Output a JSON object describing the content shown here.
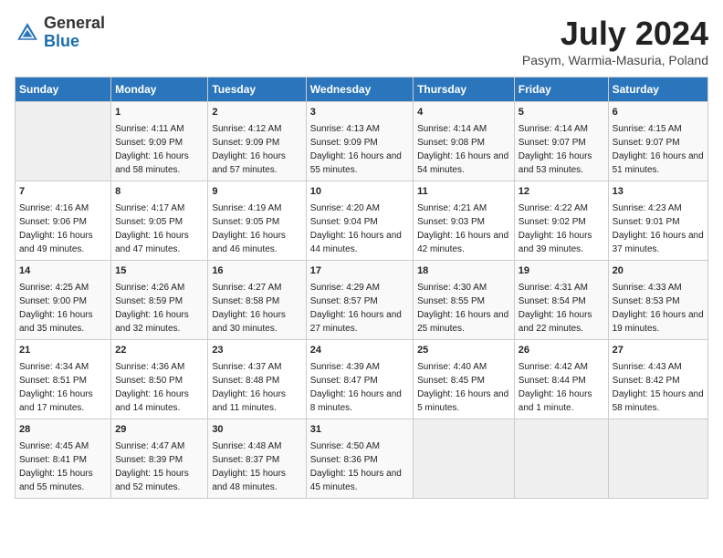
{
  "header": {
    "logo_general": "General",
    "logo_blue": "Blue",
    "month_title": "July 2024",
    "location": "Pasym, Warmia-Masuria, Poland"
  },
  "days_of_week": [
    "Sunday",
    "Monday",
    "Tuesday",
    "Wednesday",
    "Thursday",
    "Friday",
    "Saturday"
  ],
  "weeks": [
    [
      {
        "day": "",
        "sunrise": "",
        "sunset": "",
        "daylight": ""
      },
      {
        "day": "1",
        "sunrise": "Sunrise: 4:11 AM",
        "sunset": "Sunset: 9:09 PM",
        "daylight": "Daylight: 16 hours and 58 minutes."
      },
      {
        "day": "2",
        "sunrise": "Sunrise: 4:12 AM",
        "sunset": "Sunset: 9:09 PM",
        "daylight": "Daylight: 16 hours and 57 minutes."
      },
      {
        "day": "3",
        "sunrise": "Sunrise: 4:13 AM",
        "sunset": "Sunset: 9:09 PM",
        "daylight": "Daylight: 16 hours and 55 minutes."
      },
      {
        "day": "4",
        "sunrise": "Sunrise: 4:14 AM",
        "sunset": "Sunset: 9:08 PM",
        "daylight": "Daylight: 16 hours and 54 minutes."
      },
      {
        "day": "5",
        "sunrise": "Sunrise: 4:14 AM",
        "sunset": "Sunset: 9:07 PM",
        "daylight": "Daylight: 16 hours and 53 minutes."
      },
      {
        "day": "6",
        "sunrise": "Sunrise: 4:15 AM",
        "sunset": "Sunset: 9:07 PM",
        "daylight": "Daylight: 16 hours and 51 minutes."
      }
    ],
    [
      {
        "day": "7",
        "sunrise": "Sunrise: 4:16 AM",
        "sunset": "Sunset: 9:06 PM",
        "daylight": "Daylight: 16 hours and 49 minutes."
      },
      {
        "day": "8",
        "sunrise": "Sunrise: 4:17 AM",
        "sunset": "Sunset: 9:05 PM",
        "daylight": "Daylight: 16 hours and 47 minutes."
      },
      {
        "day": "9",
        "sunrise": "Sunrise: 4:19 AM",
        "sunset": "Sunset: 9:05 PM",
        "daylight": "Daylight: 16 hours and 46 minutes."
      },
      {
        "day": "10",
        "sunrise": "Sunrise: 4:20 AM",
        "sunset": "Sunset: 9:04 PM",
        "daylight": "Daylight: 16 hours and 44 minutes."
      },
      {
        "day": "11",
        "sunrise": "Sunrise: 4:21 AM",
        "sunset": "Sunset: 9:03 PM",
        "daylight": "Daylight: 16 hours and 42 minutes."
      },
      {
        "day": "12",
        "sunrise": "Sunrise: 4:22 AM",
        "sunset": "Sunset: 9:02 PM",
        "daylight": "Daylight: 16 hours and 39 minutes."
      },
      {
        "day": "13",
        "sunrise": "Sunrise: 4:23 AM",
        "sunset": "Sunset: 9:01 PM",
        "daylight": "Daylight: 16 hours and 37 minutes."
      }
    ],
    [
      {
        "day": "14",
        "sunrise": "Sunrise: 4:25 AM",
        "sunset": "Sunset: 9:00 PM",
        "daylight": "Daylight: 16 hours and 35 minutes."
      },
      {
        "day": "15",
        "sunrise": "Sunrise: 4:26 AM",
        "sunset": "Sunset: 8:59 PM",
        "daylight": "Daylight: 16 hours and 32 minutes."
      },
      {
        "day": "16",
        "sunrise": "Sunrise: 4:27 AM",
        "sunset": "Sunset: 8:58 PM",
        "daylight": "Daylight: 16 hours and 30 minutes."
      },
      {
        "day": "17",
        "sunrise": "Sunrise: 4:29 AM",
        "sunset": "Sunset: 8:57 PM",
        "daylight": "Daylight: 16 hours and 27 minutes."
      },
      {
        "day": "18",
        "sunrise": "Sunrise: 4:30 AM",
        "sunset": "Sunset: 8:55 PM",
        "daylight": "Daylight: 16 hours and 25 minutes."
      },
      {
        "day": "19",
        "sunrise": "Sunrise: 4:31 AM",
        "sunset": "Sunset: 8:54 PM",
        "daylight": "Daylight: 16 hours and 22 minutes."
      },
      {
        "day": "20",
        "sunrise": "Sunrise: 4:33 AM",
        "sunset": "Sunset: 8:53 PM",
        "daylight": "Daylight: 16 hours and 19 minutes."
      }
    ],
    [
      {
        "day": "21",
        "sunrise": "Sunrise: 4:34 AM",
        "sunset": "Sunset: 8:51 PM",
        "daylight": "Daylight: 16 hours and 17 minutes."
      },
      {
        "day": "22",
        "sunrise": "Sunrise: 4:36 AM",
        "sunset": "Sunset: 8:50 PM",
        "daylight": "Daylight: 16 hours and 14 minutes."
      },
      {
        "day": "23",
        "sunrise": "Sunrise: 4:37 AM",
        "sunset": "Sunset: 8:48 PM",
        "daylight": "Daylight: 16 hours and 11 minutes."
      },
      {
        "day": "24",
        "sunrise": "Sunrise: 4:39 AM",
        "sunset": "Sunset: 8:47 PM",
        "daylight": "Daylight: 16 hours and 8 minutes."
      },
      {
        "day": "25",
        "sunrise": "Sunrise: 4:40 AM",
        "sunset": "Sunset: 8:45 PM",
        "daylight": "Daylight: 16 hours and 5 minutes."
      },
      {
        "day": "26",
        "sunrise": "Sunrise: 4:42 AM",
        "sunset": "Sunset: 8:44 PM",
        "daylight": "Daylight: 16 hours and 1 minute."
      },
      {
        "day": "27",
        "sunrise": "Sunrise: 4:43 AM",
        "sunset": "Sunset: 8:42 PM",
        "daylight": "Daylight: 15 hours and 58 minutes."
      }
    ],
    [
      {
        "day": "28",
        "sunrise": "Sunrise: 4:45 AM",
        "sunset": "Sunset: 8:41 PM",
        "daylight": "Daylight: 15 hours and 55 minutes."
      },
      {
        "day": "29",
        "sunrise": "Sunrise: 4:47 AM",
        "sunset": "Sunset: 8:39 PM",
        "daylight": "Daylight: 15 hours and 52 minutes."
      },
      {
        "day": "30",
        "sunrise": "Sunrise: 4:48 AM",
        "sunset": "Sunset: 8:37 PM",
        "daylight": "Daylight: 15 hours and 48 minutes."
      },
      {
        "day": "31",
        "sunrise": "Sunrise: 4:50 AM",
        "sunset": "Sunset: 8:36 PM",
        "daylight": "Daylight: 15 hours and 45 minutes."
      },
      {
        "day": "",
        "sunrise": "",
        "sunset": "",
        "daylight": ""
      },
      {
        "day": "",
        "sunrise": "",
        "sunset": "",
        "daylight": ""
      },
      {
        "day": "",
        "sunrise": "",
        "sunset": "",
        "daylight": ""
      }
    ]
  ]
}
